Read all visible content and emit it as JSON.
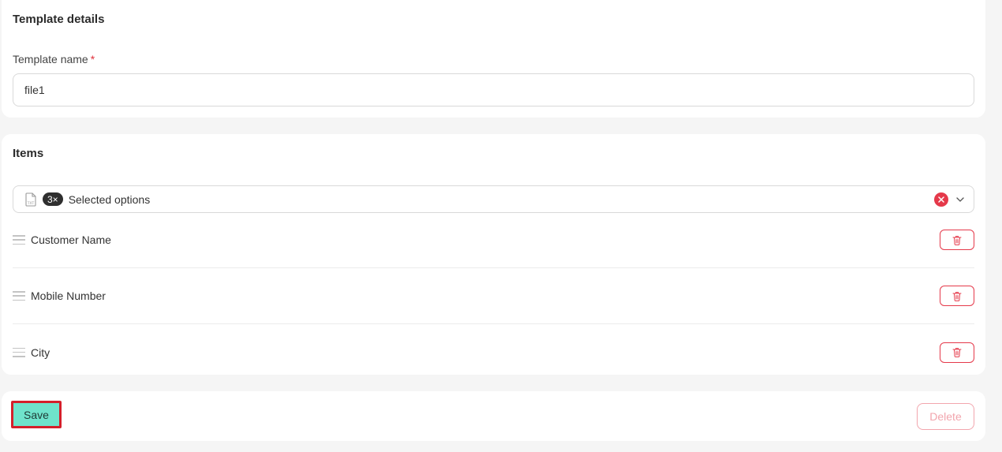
{
  "template_details": {
    "title": "Template details",
    "name_label": "Template name",
    "required_marker": "*",
    "name_value": "file1"
  },
  "items_section": {
    "title": "Items",
    "selector": {
      "icon": "txt-file-icon",
      "count_badge": "3×",
      "text": "Selected options",
      "clear_icon": "clear-x-icon",
      "dropdown_icon": "chevron-down-icon"
    },
    "items": [
      {
        "label": "Customer Name"
      },
      {
        "label": "Mobile Number"
      },
      {
        "label": "City"
      }
    ],
    "drag_icon": "drag-handle-icon",
    "delete_icon": "trash-icon"
  },
  "actions": {
    "save_label": "Save",
    "delete_label": "Delete"
  },
  "colors": {
    "accent": "#6fe3cb",
    "danger": "#e5394a",
    "highlight_border": "#d41f2a"
  }
}
